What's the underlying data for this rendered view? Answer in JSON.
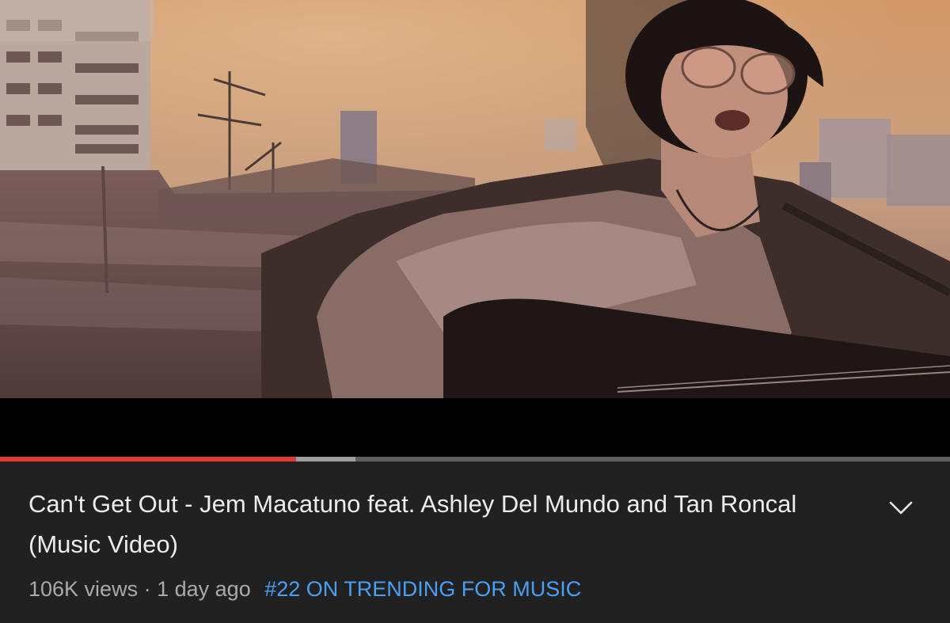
{
  "player": {
    "progress_played": 0.312,
    "progress_buffered": 0.374,
    "colors": {
      "played": "#e53a2f",
      "buffered": "#9e9e9e",
      "track": "#5f5f5f"
    }
  },
  "video": {
    "title": "Can't Get Out - Jem Macatuno feat. Ashley Del Mundo and Tan Roncal (Music Video)",
    "views": "106K views",
    "separator": "·",
    "age": "1 day ago",
    "trending": "#22 ON TRENDING FOR MUSIC"
  },
  "icons": {
    "expand": "chevron-down-icon"
  },
  "colors": {
    "background": "#212121",
    "title": "#ececec",
    "meta": "#aaaaaa",
    "trending": "#4a9ff5"
  }
}
